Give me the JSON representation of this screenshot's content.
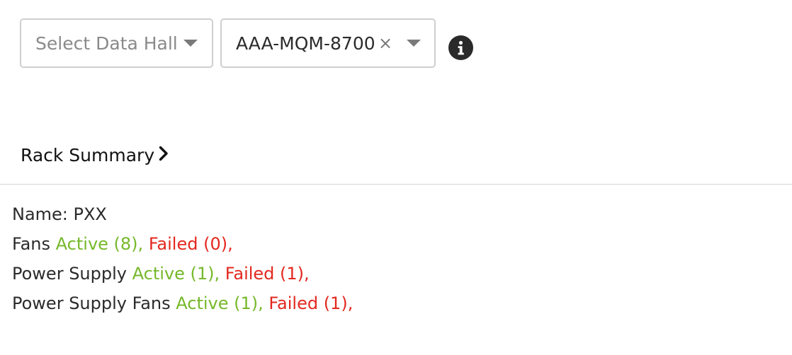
{
  "filters": {
    "data_hall_placeholder": "Select Data Hall",
    "device_value": "AAA-MQM-8700",
    "clear_glyph": "×"
  },
  "section": {
    "title": "Rack Summary"
  },
  "summary": {
    "name_label": "Name: PXX",
    "fans": {
      "label": "Fans",
      "active": "Active (8),",
      "failed": "Failed (0),"
    },
    "power_supply": {
      "label": "Power Supply",
      "active": "Active (1),",
      "failed": "Failed (1),"
    },
    "power_supply_fans": {
      "label": "Power Supply Fans",
      "active": "Active (1),",
      "failed": "Failed (1),"
    }
  },
  "colors": {
    "active": "#76b82a",
    "failed": "#e3281f"
  },
  "icons": [
    "chevron-down-icon",
    "close-icon",
    "info-icon",
    "chevron-right-icon"
  ]
}
